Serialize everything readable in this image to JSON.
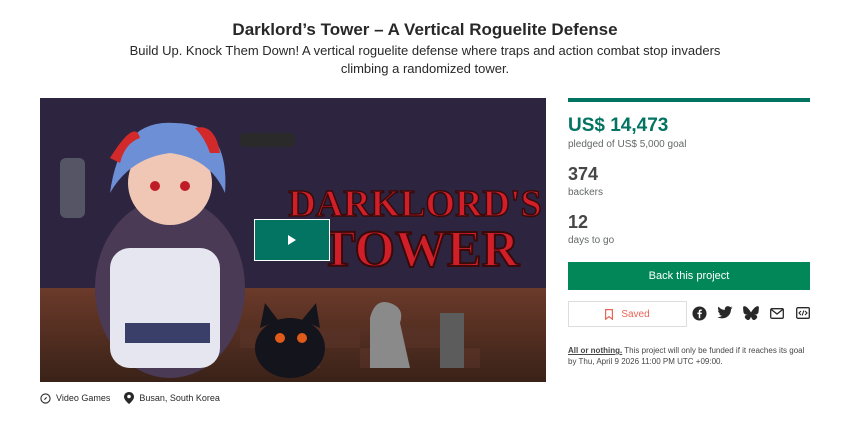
{
  "project": {
    "title": "Darklord’s Tower – A Vertical Roguelite Defense",
    "subtitle": "Build Up. Knock Them Down! A vertical roguelite defense where traps and action combat stop invaders climbing a randomized tower."
  },
  "media": {
    "logo_line1": "DARKLORD'S",
    "logo_line2": "TOWER",
    "play_icon": "play-icon"
  },
  "meta": {
    "category": "Video Games",
    "location": "Busan, South Korea",
    "category_icon": "compass-icon",
    "location_icon": "map-pin-icon"
  },
  "funding": {
    "progress": 1.0,
    "pledged": "US$ 14,473",
    "pledged_sub": "pledged of US$ 5,000 goal",
    "backers": "374",
    "backers_sub": "backers",
    "days": "12",
    "days_sub": "days to go"
  },
  "actions": {
    "back_label": "Back this project",
    "saved_label": "Saved",
    "share_icons": [
      "facebook-icon",
      "twitter-icon",
      "bluesky-icon",
      "email-icon",
      "embed-icon"
    ]
  },
  "notice": {
    "lead": "All or nothing.",
    "text": " This project will only be funded if it reaches its goal by Thu, April 9 2026 11:00 PM UTC +09:00."
  },
  "colors": {
    "accent": "#037362",
    "button": "#028858",
    "saved": "#e96656"
  }
}
